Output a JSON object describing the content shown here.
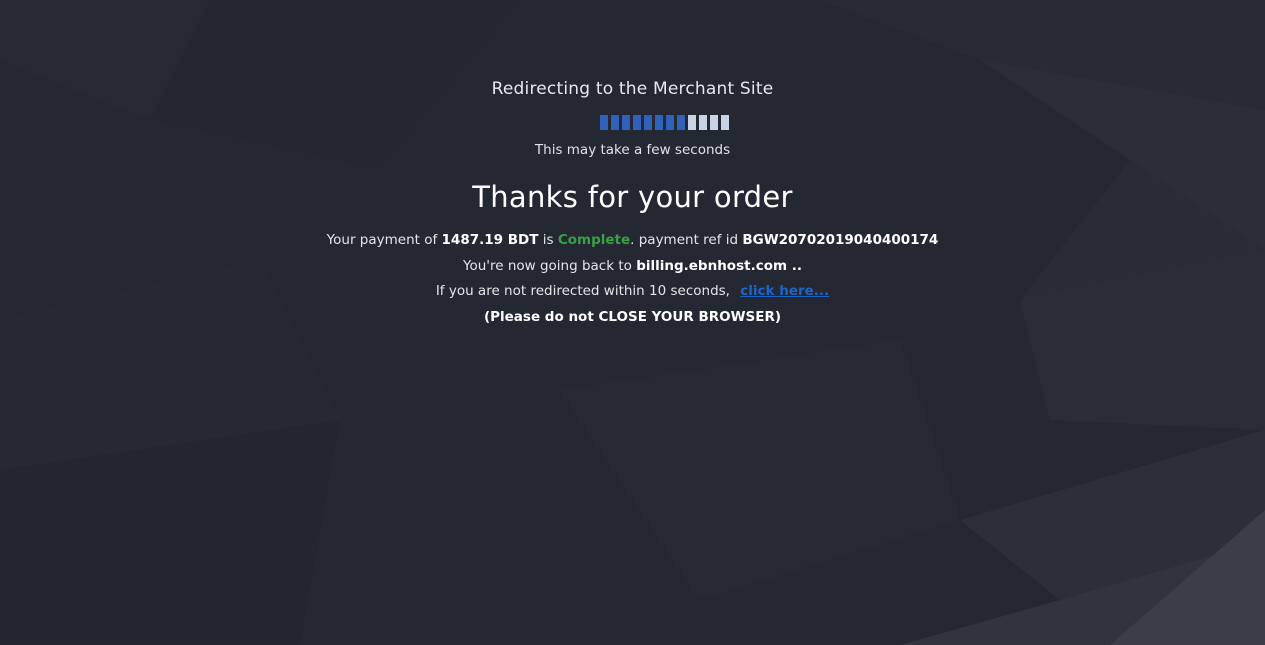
{
  "redirect": {
    "title": "Redirecting to the Merchant Site",
    "wait_note": "This may take a few seconds",
    "progress": {
      "filled_segments": 8,
      "total_segments": 12,
      "filled_color": "#2f62b8",
      "empty_color": "#c9d3e6"
    }
  },
  "order": {
    "heading": "Thanks for your order",
    "payment_prefix": "Your payment of",
    "amount": "1487.19 BDT",
    "is_text": "is",
    "status": "Complete",
    "status_color": "#3aa146",
    "ref_text": ". payment ref id",
    "ref_id": "BGW20702019040400174",
    "going_back_prefix": "You're now going back to",
    "merchant_site": "billing.ebnhost.com ..",
    "not_redirected_text": "If you are not redirected within 10 seconds,",
    "click_here_label": "click here...",
    "warning": "(Please do not CLOSE YOUR BROWSER)"
  },
  "colors": {
    "background": "#242833",
    "link": "#1f64c8"
  }
}
